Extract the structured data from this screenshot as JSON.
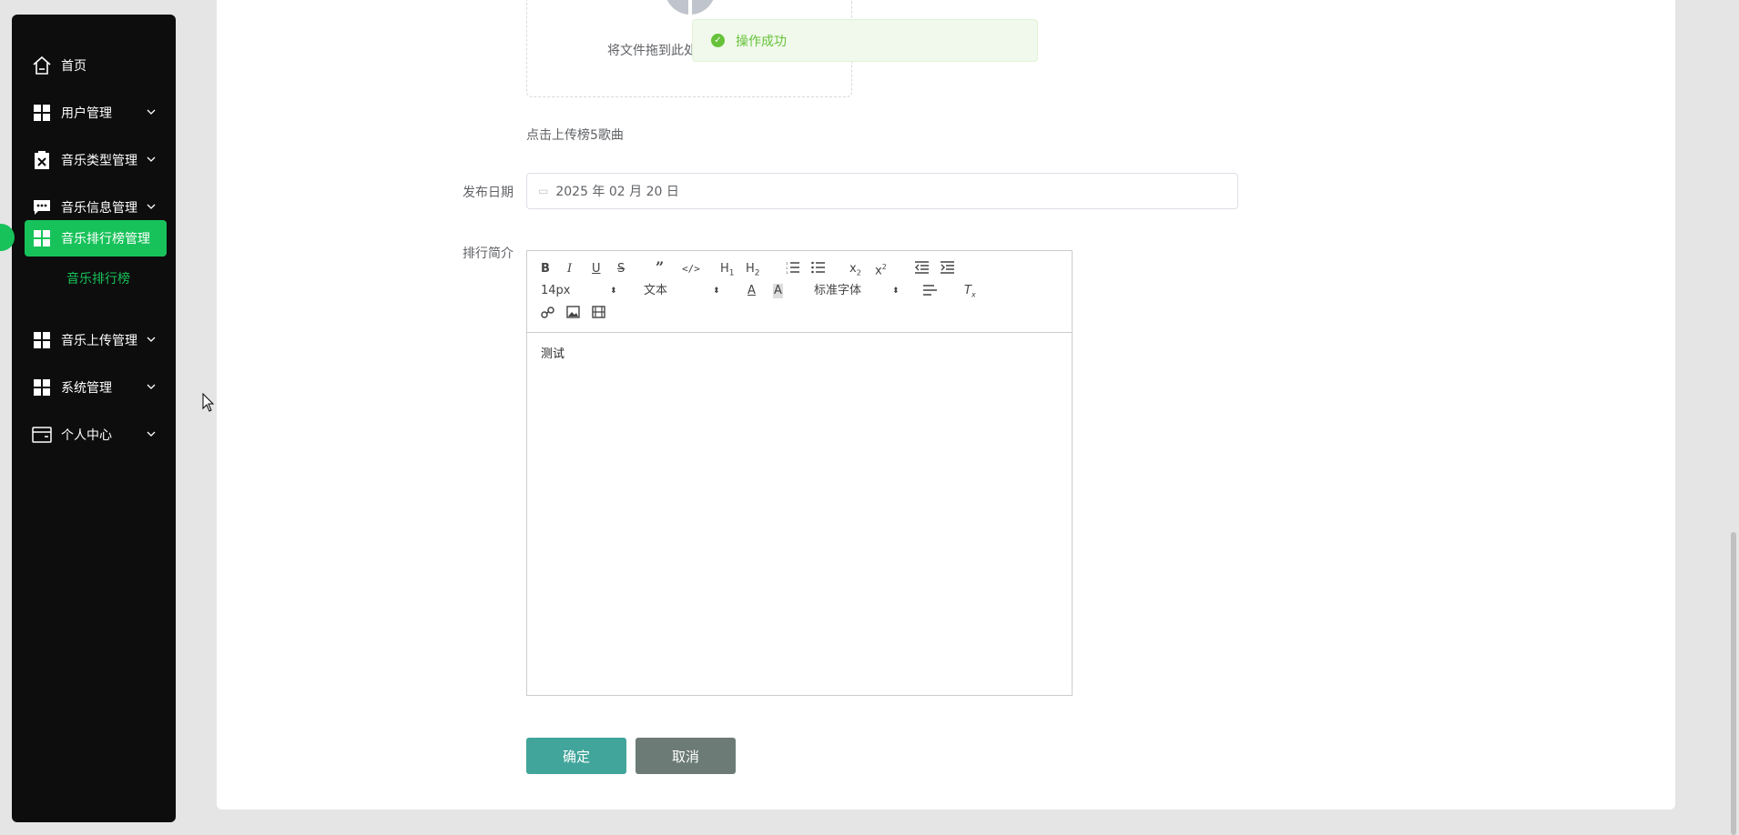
{
  "sidebar": {
    "items": [
      {
        "label": "首页",
        "icon": "home-icon",
        "has_chevron": false
      },
      {
        "label": "用户管理",
        "icon": "grid-icon",
        "has_chevron": true
      },
      {
        "label": "音乐类型管理",
        "icon": "clipboard-x-icon",
        "has_chevron": true
      },
      {
        "label": "音乐信息管理",
        "icon": "chat-icon",
        "has_chevron": true
      },
      {
        "label": "音乐排行榜管理",
        "icon": "grid-icon",
        "has_chevron": true,
        "active": true
      },
      {
        "label": "音乐上传管理",
        "icon": "grid-icon",
        "has_chevron": true
      },
      {
        "label": "系统管理",
        "icon": "grid-icon",
        "has_chevron": true
      },
      {
        "label": "个人中心",
        "icon": "wallet-icon",
        "has_chevron": true
      }
    ],
    "sub_item": "音乐排行榜"
  },
  "toast": {
    "message": "操作成功"
  },
  "upload": {
    "drop_text": "将文件拖到此处"
  },
  "form": {
    "upload_hint": "点击上传榜5歌曲",
    "date_label": "发布日期",
    "date_value": "2025 年 02 月 20 日",
    "intro_label": "排行简介",
    "editor": {
      "font_size": "14px",
      "text_type": "文本",
      "font_family": "标准字体",
      "content": "测试"
    },
    "confirm_label": "确定",
    "cancel_label": "取消"
  },
  "colors": {
    "accent": "#18c25a",
    "confirm": "#41a59b",
    "cancel": "#6c7b76",
    "toast_text": "#67c23a"
  }
}
